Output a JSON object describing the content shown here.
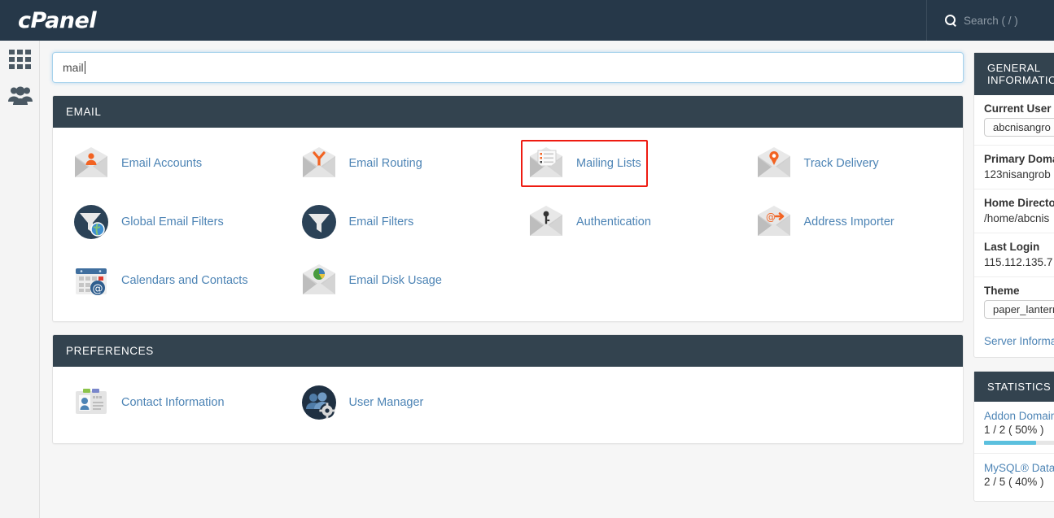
{
  "topbar": {
    "logo": "cPanel",
    "search_icon": "search-icon",
    "search_label": "Search ( / )"
  },
  "leftrail": {
    "items": [
      {
        "name": "apps-grid",
        "icon": "grid-icon"
      },
      {
        "name": "user-manager",
        "icon": "users-icon"
      }
    ]
  },
  "search": {
    "value": "mail",
    "placeholder": ""
  },
  "panels": [
    {
      "title": "EMAIL",
      "items": [
        {
          "label": "Email Accounts",
          "icon": "envelope-person-icon",
          "highlighted": false
        },
        {
          "label": "Email Routing",
          "icon": "envelope-routing-icon",
          "highlighted": false
        },
        {
          "label": "Mailing Lists",
          "icon": "envelope-list-icon",
          "highlighted": true
        },
        {
          "label": "Track Delivery",
          "icon": "envelope-pin-icon",
          "highlighted": false
        },
        {
          "label": "Global Email Filters",
          "icon": "funnel-globe-icon",
          "highlighted": false
        },
        {
          "label": "Email Filters",
          "icon": "funnel-icon",
          "highlighted": false
        },
        {
          "label": "Authentication",
          "icon": "envelope-key-icon",
          "highlighted": false
        },
        {
          "label": "Address Importer",
          "icon": "envelope-at-arrow-icon",
          "highlighted": false
        },
        {
          "label": "Calendars and Contacts",
          "icon": "calendar-at-icon",
          "highlighted": false
        },
        {
          "label": "Email Disk Usage",
          "icon": "envelope-pie-icon",
          "highlighted": false
        }
      ]
    },
    {
      "title": "PREFERENCES",
      "items": [
        {
          "label": "Contact Information",
          "icon": "id-card-icon",
          "highlighted": false
        },
        {
          "label": "User Manager",
          "icon": "users-gear-icon",
          "highlighted": false
        }
      ]
    }
  ],
  "general_info": {
    "title": "GENERAL INFORMATION",
    "rows": [
      {
        "label": "Current User",
        "value": "abcnisangro",
        "pill": true
      },
      {
        "label": "Primary Domain",
        "value": "123nisangrob",
        "pill": false
      },
      {
        "label": "Home Directory",
        "value": "/home/abcnis",
        "pill": false
      },
      {
        "label": "Last Login",
        "value": "115.112.135.7",
        "pill": false
      },
      {
        "label": "Theme",
        "value": "paper_lantern",
        "pill": true
      }
    ],
    "link": "Server Information"
  },
  "statistics": {
    "title": "STATISTICS",
    "rows": [
      {
        "name": "Addon Domains",
        "value": "1 / 2 ( 50% )",
        "percent": 50,
        "show_bar": true
      },
      {
        "name": "MySQL® Databases",
        "value": "2 / 5 ( 40% )",
        "percent": 40,
        "show_bar": false
      }
    ]
  },
  "colors": {
    "topbar": "#263849",
    "panel_header": "#33434f",
    "link": "#4d84b5",
    "highlight": "#ee1b11",
    "accent_orange": "#f26322",
    "progress": "#5bc0de"
  }
}
